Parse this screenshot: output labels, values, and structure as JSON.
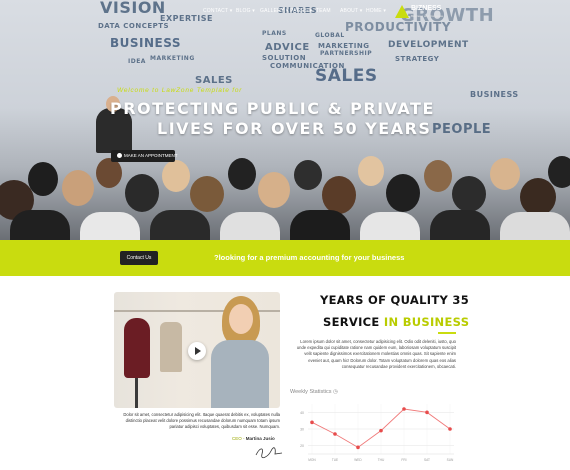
{
  "nav": {
    "items": [
      {
        "label": "CONTACT ▾"
      },
      {
        "label": "BLOG ▾"
      },
      {
        "label": "GALLERY ▾"
      },
      {
        "label": "PAGES ▾"
      },
      {
        "label": "TEAM"
      },
      {
        "label": "ABOUT ▾"
      },
      {
        "label": "HOME ▾"
      }
    ],
    "brand_name": "BIZNESS",
    "brand_tagline": "Business and Corporate"
  },
  "hero": {
    "subtitle": "Welcome to LawZone Template for",
    "title_line1": "PROTECTING PUBLIC & PRIVATE",
    "title_line2": "LIVES FOR OVER 50 YEARS",
    "appointment_button": "MAKE AN APPOINTMENT",
    "background_words": [
      "VISION",
      "EXPERTISE",
      "BUSINESS",
      "DATA CONCEPTS",
      "ADVICE",
      "SOLUTION",
      "SALES",
      "COMMUNICATION",
      "GLOBAL",
      "MARKETING",
      "PARTNERSHIP",
      "PRODUCTIVITY",
      "DEVELOPMENT",
      "STRATEGY",
      "PLANS",
      "PEOPLE",
      "GROWTH",
      "MARKETING",
      "SALES",
      "BUSINESS",
      "SHARES",
      "IDEA"
    ]
  },
  "band": {
    "button": "Contact Us",
    "text": "?looking for a premium accounting for your business"
  },
  "video": {
    "quote": "Dolor sit amet, consectetur adipisicing elit. Itaque quaerat debitis ex, voluptates nulla distinctio placeat velit dolore possimus recusandae dolorum numquam totam ipsum pariatur adipisci voluptates, quibusdam sit esse. Numquam.",
    "ceo_role": "CEO -",
    "ceo_name": "Martina Jusio"
  },
  "about": {
    "title_line1": "YEARS OF QUALITY 35",
    "title_line2_prefix": "SERVICE",
    "title_line2_highlight": "IN BUSINESS",
    "body": "Lorem ipsum dolor sit amet, consectetur adipisicing elit. Odio odit deleniti, iusto, quo unde expedita qui cupiditate ratione nam quidem eum, laboriosam voluptatum suscipit velit sapiente dignissimos exercitationem molestias omnis quas. Sit sapiente enim eveniet aut, quam hic! Dolorum dolor. Totam voluptatum dolorem quas eos alias consequatur recusandae provident exercitationem, obcaecati."
  },
  "weekly_stats": {
    "title": "Weekly Statistics",
    "title_icon": "chart-icon"
  },
  "chart_data": {
    "type": "line",
    "title": "Weekly Statistics",
    "categories": [
      "MON",
      "TUE",
      "WED",
      "THU",
      "FRI",
      "SAT",
      "SUN"
    ],
    "series": [
      {
        "values": [
          34,
          27,
          19,
          29,
          42,
          40,
          30
        ]
      }
    ],
    "yticks": [
      20,
      30,
      40
    ],
    "ylim": [
      15,
      45
    ],
    "grid": true,
    "line_color": "#f07a7a",
    "marker_color": "#e74c4c"
  },
  "colors": {
    "accent": "#c9dc0f",
    "dark_button": "#222222"
  }
}
